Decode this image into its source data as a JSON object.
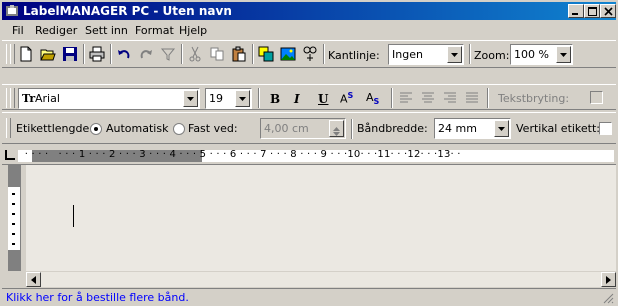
{
  "window": {
    "title": "LabelMANAGER PC - Uten navn",
    "accent": "#000080"
  },
  "menubar": {
    "items": [
      {
        "label": "Fil"
      },
      {
        "label": "Rediger"
      },
      {
        "label": "Sett inn"
      },
      {
        "label": "Format"
      },
      {
        "label": "Hjelp"
      }
    ]
  },
  "toolbar1": {
    "icons": [
      "new-document-icon",
      "open-folder-icon",
      "save-icon",
      "print-icon",
      "undo-icon",
      "redo-icon",
      "filter-icon",
      "cut-icon",
      "copy-icon",
      "paste-icon",
      "insert-image-icon",
      "picture-icon",
      "symbol-icon"
    ],
    "border_label": "Kantlinje:",
    "border_value": "Ingen",
    "zoom_label": "Zoom:",
    "zoom_value": "100 %"
  },
  "toolbar2": {
    "font_value": "Arial",
    "font_prefix": "Tr",
    "size_value": "19",
    "bold": "B",
    "italic": "I",
    "underline": "U",
    "superscript": "A",
    "superscript_mark": "S",
    "subscript": "A",
    "subscript_mark": "S",
    "wrap_label": "Tekstbryting:"
  },
  "toolbar3": {
    "length_label": "Etikettlengde:",
    "auto_label": "Automatisk",
    "fixed_label": "Fast ved:",
    "fixed_value": "4,00 cm",
    "tape_width_label": "Båndbredde:",
    "tape_width_value": "24 mm",
    "vertical_label": "Vertikal etikett:"
  },
  "ruler": {
    "text": "  · · · ·   · · · 1 · · · 2 · · · 3 · · · 4 · · · 5 · · · 6 · · · 7 · · · 8 · · · 9 · · ·10· · ·11· · ·12· · ·13· ·"
  },
  "status": {
    "text": "Klikk her for å bestille flere bånd.",
    "color": "#0000ff"
  }
}
